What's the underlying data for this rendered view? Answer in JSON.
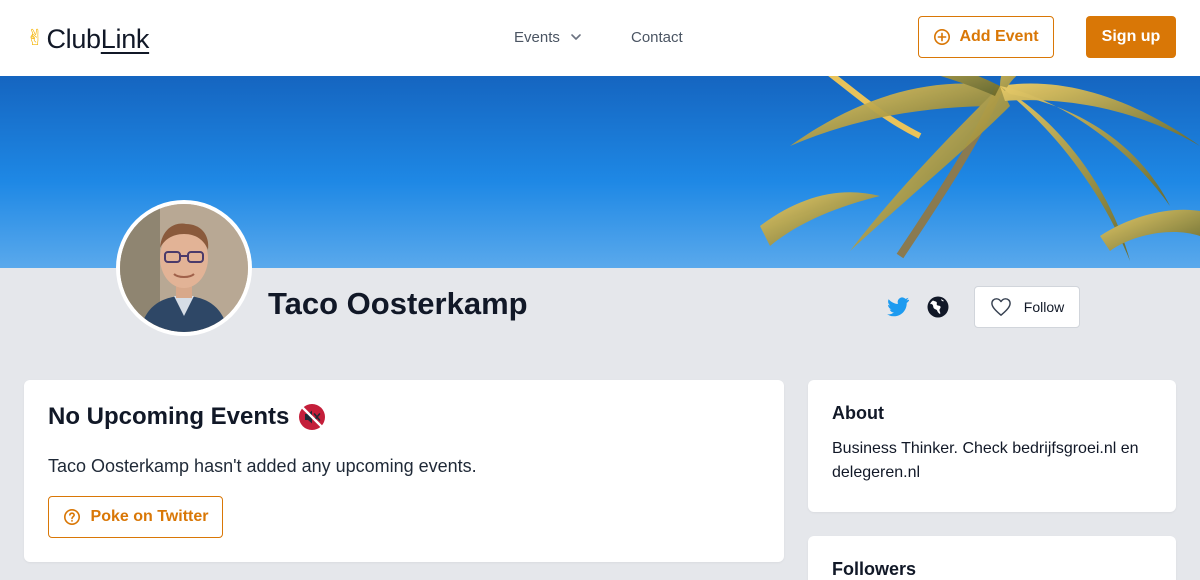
{
  "header": {
    "logo_prefix": "Club",
    "logo_suffix": "Link",
    "nav": {
      "events_label": "Events",
      "contact_label": "Contact"
    },
    "add_event_label": "Add Event",
    "signup_label": "Sign up"
  },
  "profile": {
    "name": "Taco Oosterkamp",
    "follow_label": "Follow"
  },
  "events": {
    "title": "No Upcoming Events",
    "message": "Taco Oosterkamp hasn't added any upcoming events.",
    "poke_label": "Poke on Twitter"
  },
  "about": {
    "title": "About",
    "text": "Business Thinker. Check bedrijfsgroei.nl en delegeren.nl"
  },
  "followers": {
    "title": "Followers"
  },
  "colors": {
    "accent": "#d97706",
    "page_background": "#e5e7eb",
    "twitter": "#1d9bf0"
  },
  "icons": {
    "logo": "victory-hand-icon",
    "events_dropdown": "chevron-down-icon",
    "add_event": "plus-circle-icon",
    "twitter": "twitter-icon",
    "website": "globe-icon",
    "follow": "heart-outline-icon",
    "no_events": "muted-speaker-icon",
    "poke": "question-circle-icon"
  }
}
